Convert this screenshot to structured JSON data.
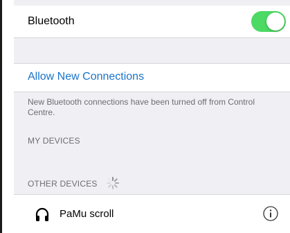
{
  "bluetooth": {
    "label": "Bluetooth",
    "enabled": true,
    "toggle_color": "#4cd964"
  },
  "allow_new": {
    "label": "Allow New Connections",
    "color": "#1a73c9"
  },
  "note": "New Bluetooth connections have been turned off from Control Centre.",
  "sections": {
    "my_devices": "MY DEVICES",
    "other_devices": "OTHER DEVICES"
  },
  "devices": [
    {
      "name": "PaMu scroll",
      "icon": "headphones-icon",
      "detail_icon": "info-icon"
    }
  ]
}
